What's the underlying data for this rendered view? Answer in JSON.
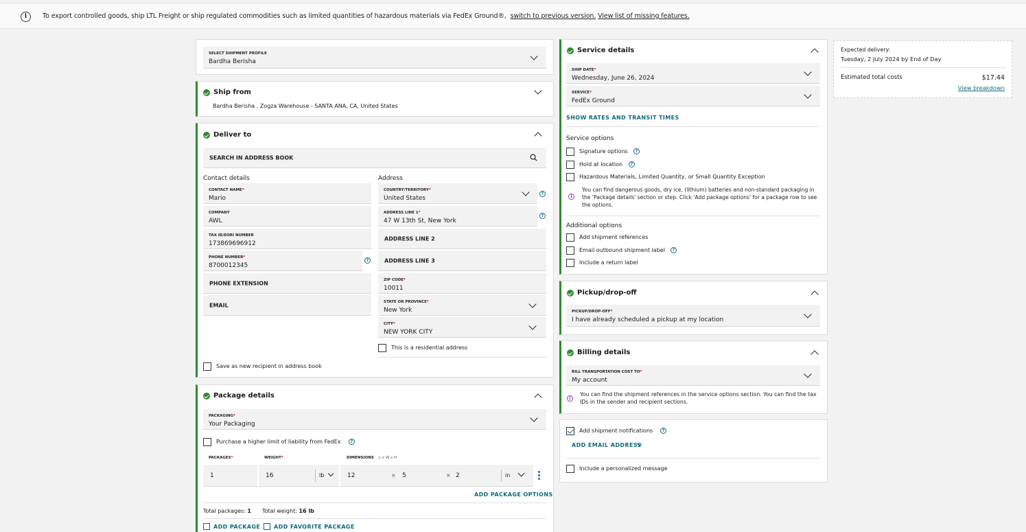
{
  "banner": {
    "text": "To export controlled goods, ship LTL Freight or ship regulated commodities such as limited quantities of hazardous materials via FedEx Ground®,",
    "link1": "switch to previous version.",
    "link2": "View list of missing features."
  },
  "profile": {
    "label": "SELECT SHIPMENT PROFILE",
    "value": "Bardha Berisha"
  },
  "ship_from": {
    "title": "Ship from",
    "summary": "Bardha Berisha , Zogza Warehouse - SANTA ANA, CA, United States"
  },
  "deliver_to": {
    "title": "Deliver to",
    "search_placeholder": "SEARCH IN ADDRESS BOOK",
    "contact_heading": "Contact details",
    "address_heading": "Address",
    "contact_name": {
      "label": "CONTACT NAME",
      "value": "Mario"
    },
    "company": {
      "label": "COMPANY",
      "value": "AWL"
    },
    "tax_id": {
      "label": "TAX ID/EORI NUMBER",
      "value": "173869696912"
    },
    "phone": {
      "label": "PHONE NUMBER",
      "value": "8700012345"
    },
    "phone_ext": "PHONE EXTENSION",
    "email": "EMAIL",
    "country": {
      "label": "COUNTRY/TERRITORY",
      "value": "United States"
    },
    "address1": {
      "label": "ADDRESS LINE 1",
      "value": "47 W 13th St, New York"
    },
    "address2": "ADDRESS LINE 2",
    "address3": "ADDRESS LINE 3",
    "zip": {
      "label": "ZIP CODE",
      "value": "10011"
    },
    "state": {
      "label": "STATE OR PROVINCE",
      "value": "New York"
    },
    "city": {
      "label": "CITY",
      "value": "NEW YORK CITY"
    },
    "residential": "This is a residential address",
    "save_recipient": "Save as new recipient in address book"
  },
  "package_details": {
    "title": "Package details",
    "packaging": {
      "label": "PACKAGING",
      "value": "Your Packaging"
    },
    "liability": "Purchase a higher limit of liability from FedEx",
    "col_packages": "PACKAGES",
    "col_weight": "WEIGHT",
    "col_dimensions": "DIMENSIONS",
    "dim_hint": "L x W x H",
    "packages": "1",
    "weight": "16",
    "weight_unit": "lb",
    "dim_l": "12",
    "dim_w": "5",
    "dim_h": "2",
    "dim_unit": "in",
    "x": "×",
    "add_options": "ADD PACKAGE OPTIONS",
    "total_packages_label": "Total packages:",
    "total_packages": "1",
    "total_weight_label": "Total weight:",
    "total_weight": "16 lb",
    "add_package": "ADD PACKAGE",
    "add_favorite": "ADD FAVORITE PACKAGE"
  },
  "service_details": {
    "title": "Service details",
    "ship_date": {
      "label": "SHIP DATE",
      "value": "Wednesday, June 26, 2024"
    },
    "service": {
      "label": "SERVICE",
      "value": "FedEx Ground"
    },
    "show_rates": "SHOW RATES AND TRANSIT TIMES",
    "service_options_heading": "Service options",
    "opt_signature": "Signature options",
    "opt_hold": "Hold at location",
    "opt_hazmat": "Hazardous Materials, Limited Quantity, or Small Quantity Exception",
    "hazmat_note": "You can find dangerous goods, dry ice, (lithium) batteries and non-standard packaging in the 'Package details' section or step. Click 'Add package options' for a package row to see the options.",
    "additional_heading": "Additional options",
    "opt_references": "Add shipment references",
    "opt_email_label": "Email outbound shipment label",
    "opt_return": "Include a return label"
  },
  "pickup": {
    "title": "Pickup/drop-off",
    "field": {
      "label": "PICKUP/DROP-OFF",
      "value": "I have already scheduled a pickup at my location"
    }
  },
  "billing": {
    "title": "Billing details",
    "field": {
      "label": "BILL TRANSPORTATION COST TO",
      "value": "My account"
    },
    "note": "You can find the shipment references in the service options section. You can find the tax IDs in the sender and recipient sections."
  },
  "notifications": {
    "add_notifications": "Add shipment notifications",
    "add_email": "ADD EMAIL ADDRESS",
    "personal_msg": "Include a personalized message"
  },
  "summary": {
    "expected_label": "Expected delivery:",
    "expected_value": "Tuesday, 2 July 2024 by End of Day",
    "cost_label": "Estimated total costs",
    "cost_value": "$17.44",
    "breakdown": "View breakdown"
  },
  "colors": {
    "accent": "#0f6a7a",
    "success": "#2e8b2e",
    "required": "#dd0000"
  }
}
